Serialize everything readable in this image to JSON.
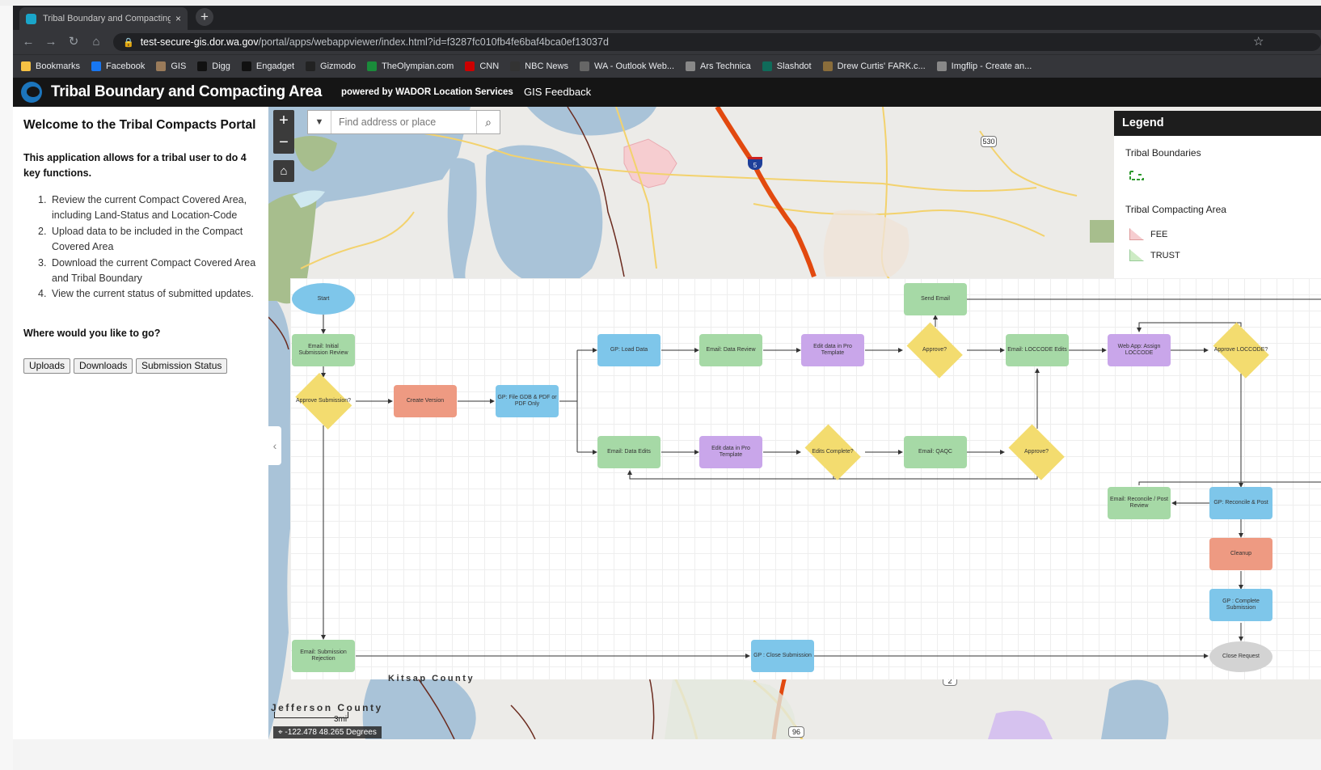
{
  "browser": {
    "tab_title": "Tribal Boundary and Compacting Area",
    "tab_close": "×",
    "new_tab": "+",
    "url_domain": "test-secure-gis.dor.wa.gov",
    "url_path": "/portal/apps/webappviewer/index.html?id=f3287fc010fb4fe6baf4bca0ef13037d",
    "bookmarks": [
      {
        "label": "Bookmarks",
        "icon": "folder-icon",
        "color": "#f6c244"
      },
      {
        "label": "Facebook",
        "icon": "facebook-icon",
        "color": "#1877f2"
      },
      {
        "label": "GIS",
        "icon": "gis-icon",
        "color": "#9a7b5a"
      },
      {
        "label": "Digg",
        "icon": "digg-icon",
        "color": "#111111"
      },
      {
        "label": "Engadget",
        "icon": "engadget-icon",
        "color": "#111111"
      },
      {
        "label": "Gizmodo",
        "icon": "gizmodo-icon",
        "color": "#222222"
      },
      {
        "label": "TheOlympian.com",
        "icon": "olympian-icon",
        "color": "#1a8b3a"
      },
      {
        "label": "CNN",
        "icon": "cnn-icon",
        "color": "#cc0000"
      },
      {
        "label": "NBC News",
        "icon": "nbc-icon",
        "color": "#333333"
      },
      {
        "label": "WA - Outlook Web...",
        "icon": "outlook-icon",
        "color": "#666666"
      },
      {
        "label": "Ars Technica",
        "icon": "page-icon",
        "color": "#888888"
      },
      {
        "label": "Slashdot",
        "icon": "slashdot-icon",
        "color": "#0f6b5a"
      },
      {
        "label": "Drew Curtis' FARK.c...",
        "icon": "fark-icon",
        "color": "#8a6d3b"
      },
      {
        "label": "Imgflip - Create an...",
        "icon": "page-icon",
        "color": "#888888"
      }
    ]
  },
  "app": {
    "title": "Tribal Boundary and Compacting Area",
    "powered_by": "powered by WADOR Location Services",
    "feedback_link": "GIS Feedback"
  },
  "panel": {
    "heading": "Welcome to the Tribal Compacts Portal",
    "intro": "This application allows for a tribal user to do 4 key functions.",
    "functions": [
      {
        "num": "1.",
        "text": "Review the current Compact Covered Area, including Land-Status and Location-Code"
      },
      {
        "num": "2.",
        "text": "Upload data to be included in the Compact Covered Area"
      },
      {
        "num": "3.",
        "text": "Download the current Compact Covered Area and Tribal Boundary"
      },
      {
        "num": "4.",
        "text": "View the current status of submitted updates."
      }
    ],
    "question": "Where would you like to go?",
    "buttons": {
      "uploads": "Uploads",
      "downloads": "Downloads",
      "status": "Submission Status"
    }
  },
  "map": {
    "search_placeholder": "Find address or place",
    "zoom_in": "+",
    "zoom_out": "−",
    "legend": {
      "title": "Legend",
      "section1": "Tribal Boundaries",
      "section2": "Tribal Compacting Area",
      "items": [
        {
          "label": "FEE",
          "color": "#f6cdd0"
        },
        {
          "label": "TRUST",
          "color": "#cdebc4"
        }
      ]
    },
    "labels": {
      "county1": "Jefferson County",
      "county2": "Kitsap County",
      "scale": "3mi",
      "coords": "-122.478 48.265 Degrees"
    },
    "shields": {
      "i5": "5",
      "sr530": "530",
      "sr96": "96",
      "sr2": "2"
    }
  },
  "flowchart": {
    "start": "Start",
    "email_initial": "Email: Initial Submission Review",
    "approve_submission": "Approve Submission?",
    "create_version": "Create Version",
    "gp_file": "GP: File GDB & PDF or PDF Only",
    "gp_load": "GP: Load Data",
    "email_data_review": "Email: Data Review",
    "edit_pro_1": "Edit data in Pro Template",
    "approve_1": "Approve?",
    "send_email": "Send Email",
    "email_loccode_edits": "Email: LOCCODE Edits",
    "webapp_assign": "Web App: Assign LOCCODE",
    "approve_loccode": "Approve LOCCODE?",
    "email_data_edits": "Email: Data Edits",
    "edit_pro_2": "Edit data in Pro Template",
    "edits_complete": "Edits Complete?",
    "email_qaqc": "Email: QAQC",
    "approve_2": "Approve?",
    "email_reconcile": "Email: Reconcile / Post Review",
    "gp_reconcile": "GP: Reconcile & Post",
    "cleanup": "Cleanup",
    "gp_complete": "GP : Complete Submission",
    "close_request": "Close Request",
    "email_rejection": "Email: Submission Rejection",
    "gp_close": "GP : Close Submission"
  }
}
